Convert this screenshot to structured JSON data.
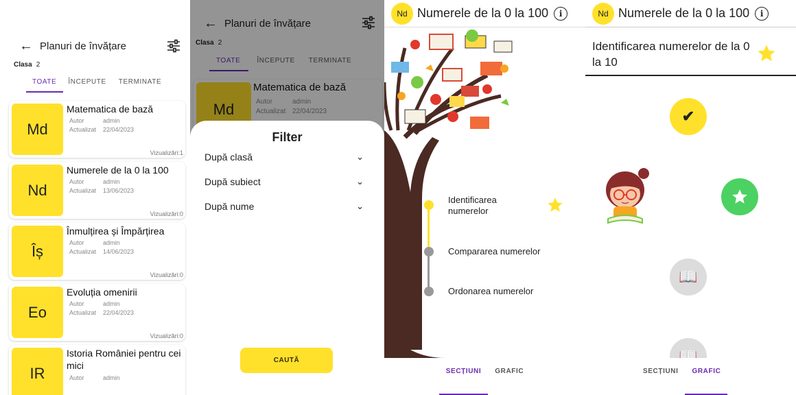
{
  "screen1": {
    "title": "Planuri de învățare",
    "clasa_label": "Clasa",
    "clasa_value": "2",
    "tabs": [
      "TOATE",
      "ÎNCEPUTE",
      "TERMINATE"
    ],
    "author_label": "Autor",
    "updated_label": "Actualizat",
    "cards": [
      {
        "abbr": "Md",
        "title": "Matematica de bază",
        "author": "admin",
        "updated": "22/04/2023",
        "views": "Vizualizări:1"
      },
      {
        "abbr": "Nd",
        "title": "Numerele de la 0 la 100",
        "author": "admin",
        "updated": "13/06/2023",
        "views": "Vizualizări:0"
      },
      {
        "abbr": "Îș",
        "title": "Înmulțirea și Împărțirea",
        "author": "admin",
        "updated": "14/06/2023",
        "views": "Vizualizări:0"
      },
      {
        "abbr": "Eo",
        "title": "Evoluția omenirii",
        "author": "admin",
        "updated": "22/04/2023",
        "views": "Vizualizări:0"
      },
      {
        "abbr": "IR",
        "title": "Istoria României pentru cei mici",
        "author": "admin",
        "updated": "",
        "views": ""
      }
    ]
  },
  "screen2": {
    "title": "Planuri de învățare",
    "clasa_label": "Clasa",
    "clasa_value": "2",
    "tabs": [
      "TOATE",
      "ÎNCEPUTE",
      "TERMINATE"
    ],
    "bg_card": {
      "abbr": "Md",
      "title": "Matematica de bază",
      "author_label": "Autor",
      "author": "admin",
      "updated_label": "Actualizat",
      "updated": "22/04/2023"
    },
    "sheet_title": "Filter",
    "filters": [
      "După clasă",
      "După subiect",
      "După nume"
    ],
    "search_button": "CAUTĂ"
  },
  "screen3": {
    "badge": "Nd",
    "title": "Numerele de la 0 la 100",
    "sections": [
      {
        "label": "Identificarea numerelor",
        "starred": true
      },
      {
        "label": "Compararea numerelor",
        "starred": false
      },
      {
        "label": "Ordonarea numerelor",
        "starred": false
      }
    ],
    "tabs": [
      "SECȚIUNI",
      "GRAFIC"
    ],
    "active_tab": "SECȚIUNI"
  },
  "screen4": {
    "badge": "Nd",
    "title": "Numerele de la 0 la 100",
    "lesson_title": "Identificarea numerelor de la 0 la 10",
    "tabs": [
      "SECȚIUNI",
      "GRAFIC"
    ],
    "active_tab": "GRAFIC"
  },
  "colors": {
    "yellow": "#ffe12b",
    "purple": "#6a2bb0",
    "green": "#4cd163",
    "gray": "#dcdcdc"
  }
}
